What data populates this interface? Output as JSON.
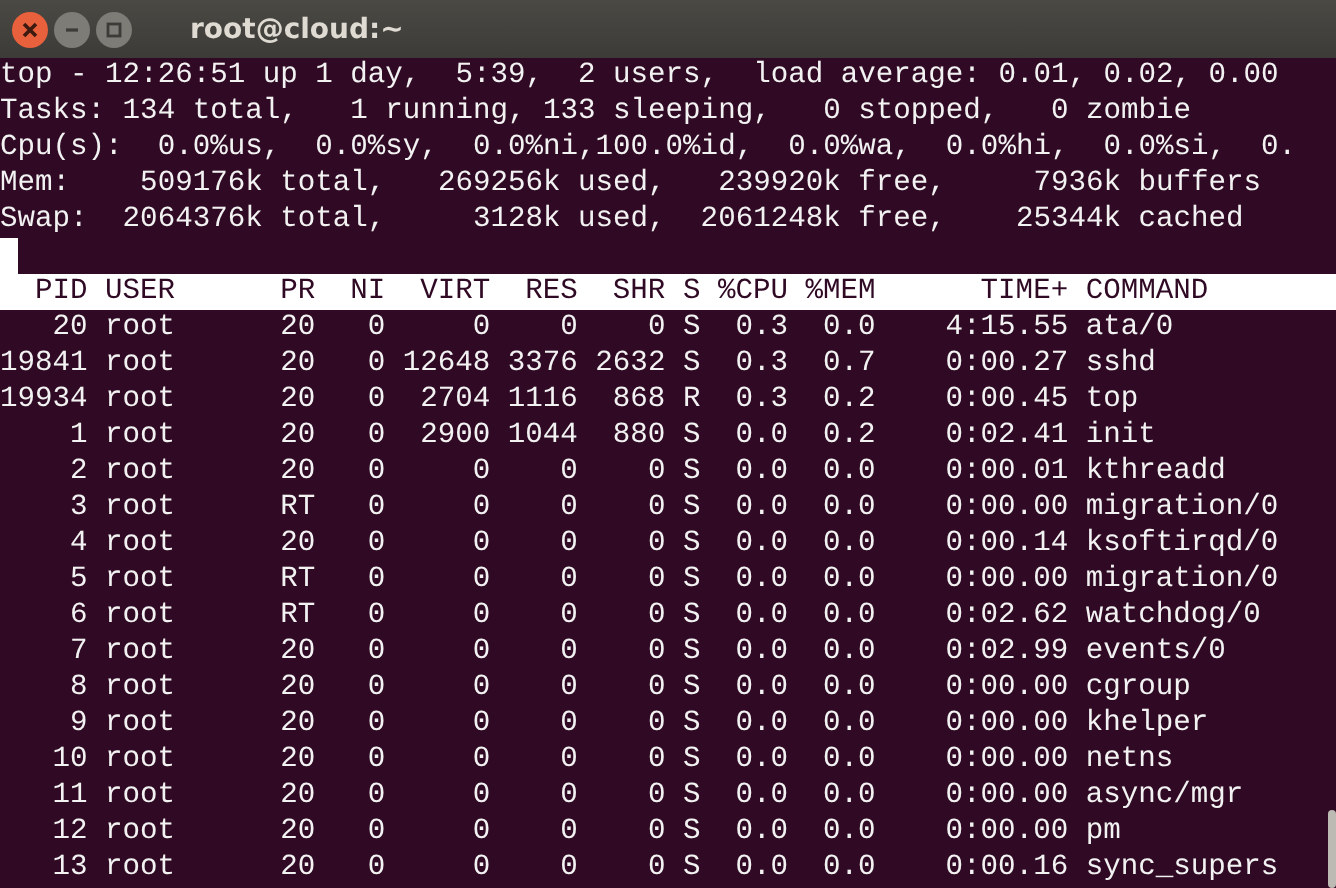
{
  "window": {
    "title": "root@cloud:~"
  },
  "summary": [
    "top - 12:26:51 up 1 day,  5:39,  2 users,  load average: 0.01, 0.02, 0.00",
    "Tasks: 134 total,   1 running, 133 sleeping,   0 stopped,   0 zombie",
    "Cpu(s):  0.0%us,  0.0%sy,  0.0%ni,100.0%id,  0.0%wa,  0.0%hi,  0.0%si,  0.",
    "Mem:    509176k total,   269256k used,   239920k free,     7936k buffers",
    "Swap:  2064376k total,     3128k used,  2061248k free,    25344k cached"
  ],
  "table": {
    "columns": [
      "PID",
      "USER",
      "PR",
      "NI",
      "VIRT",
      "RES",
      "SHR",
      "S",
      "%CPU",
      "%MEM",
      "TIME+",
      "COMMAND"
    ],
    "rows": [
      [
        "20",
        "root",
        "20",
        "0",
        "0",
        "0",
        "0",
        "S",
        "0.3",
        "0.0",
        "4:15.55",
        "ata/0"
      ],
      [
        "19841",
        "root",
        "20",
        "0",
        "12648",
        "3376",
        "2632",
        "S",
        "0.3",
        "0.7",
        "0:00.27",
        "sshd"
      ],
      [
        "19934",
        "root",
        "20",
        "0",
        "2704",
        "1116",
        "868",
        "R",
        "0.3",
        "0.2",
        "0:00.45",
        "top"
      ],
      [
        "1",
        "root",
        "20",
        "0",
        "2900",
        "1044",
        "880",
        "S",
        "0.0",
        "0.2",
        "0:02.41",
        "init"
      ],
      [
        "2",
        "root",
        "20",
        "0",
        "0",
        "0",
        "0",
        "S",
        "0.0",
        "0.0",
        "0:00.01",
        "kthreadd"
      ],
      [
        "3",
        "root",
        "RT",
        "0",
        "0",
        "0",
        "0",
        "S",
        "0.0",
        "0.0",
        "0:00.00",
        "migration/0"
      ],
      [
        "4",
        "root",
        "20",
        "0",
        "0",
        "0",
        "0",
        "S",
        "0.0",
        "0.0",
        "0:00.14",
        "ksoftirqd/0"
      ],
      [
        "5",
        "root",
        "RT",
        "0",
        "0",
        "0",
        "0",
        "S",
        "0.0",
        "0.0",
        "0:00.00",
        "migration/0"
      ],
      [
        "6",
        "root",
        "RT",
        "0",
        "0",
        "0",
        "0",
        "S",
        "0.0",
        "0.0",
        "0:02.62",
        "watchdog/0"
      ],
      [
        "7",
        "root",
        "20",
        "0",
        "0",
        "0",
        "0",
        "S",
        "0.0",
        "0.0",
        "0:02.99",
        "events/0"
      ],
      [
        "8",
        "root",
        "20",
        "0",
        "0",
        "0",
        "0",
        "S",
        "0.0",
        "0.0",
        "0:00.00",
        "cgroup"
      ],
      [
        "9",
        "root",
        "20",
        "0",
        "0",
        "0",
        "0",
        "S",
        "0.0",
        "0.0",
        "0:00.00",
        "khelper"
      ],
      [
        "10",
        "root",
        "20",
        "0",
        "0",
        "0",
        "0",
        "S",
        "0.0",
        "0.0",
        "0:00.00",
        "netns"
      ],
      [
        "11",
        "root",
        "20",
        "0",
        "0",
        "0",
        "0",
        "S",
        "0.0",
        "0.0",
        "0:00.00",
        "async/mgr"
      ],
      [
        "12",
        "root",
        "20",
        "0",
        "0",
        "0",
        "0",
        "S",
        "0.0",
        "0.0",
        "0:00.00",
        "pm"
      ],
      [
        "13",
        "root",
        "20",
        "0",
        "0",
        "0",
        "0",
        "S",
        "0.0",
        "0.0",
        "0:00.16",
        "sync_supers"
      ]
    ]
  }
}
